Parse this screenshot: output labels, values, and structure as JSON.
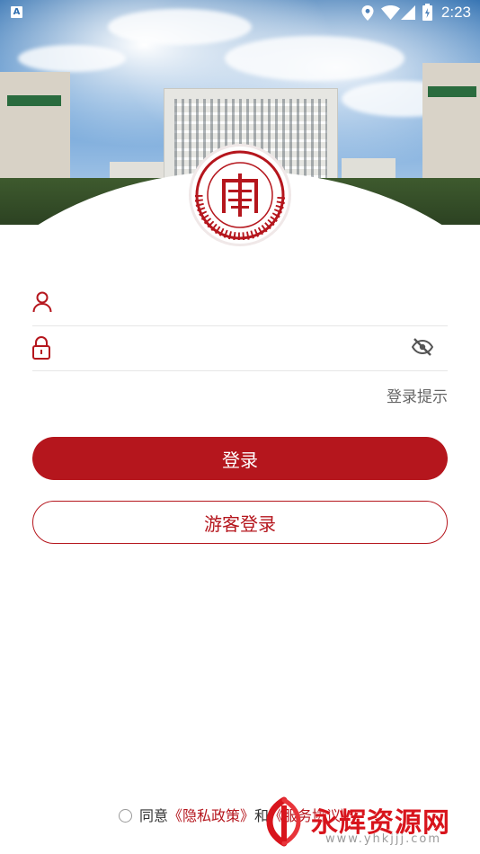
{
  "status_bar": {
    "time": "2:23",
    "notification_glyph": "A"
  },
  "login_form": {
    "username_value": "",
    "password_value": "",
    "login_hint_label": "登录提示",
    "login_button_label": "登录",
    "guest_login_button_label": "游客登录"
  },
  "agreement": {
    "prefix": "同意",
    "privacy_link": "《隐私政策》",
    "conjunction": "和",
    "terms_link": "《服务协议》"
  },
  "watermark": {
    "name": "永辉资源网",
    "url": "www.yhkjjj.com"
  },
  "colors": {
    "brand_red": "#b5161d",
    "line_gray": "#e6e6e6"
  },
  "icons": [
    "user-icon",
    "lock-icon",
    "eye-off-icon",
    "location-icon",
    "wifi-icon",
    "signal-icon",
    "battery-icon"
  ]
}
